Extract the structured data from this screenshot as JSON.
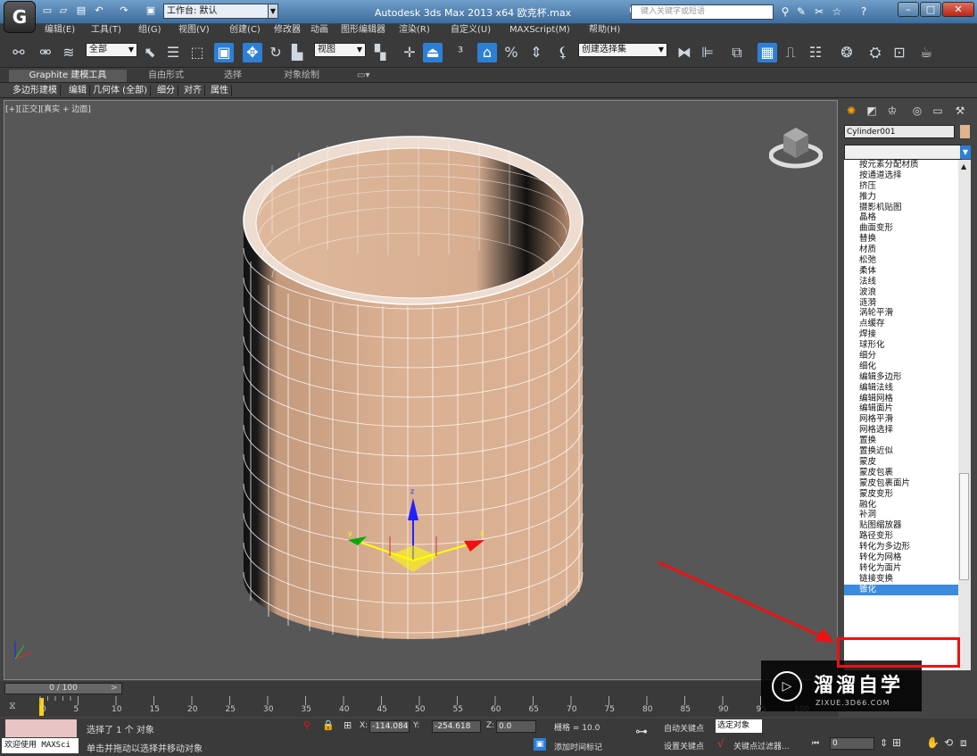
{
  "app": {
    "logo": "G",
    "title": "Autodesk 3ds Max  2013 x64    欧克杯.max",
    "workspace": "工作台: 默认",
    "search_placeholder": "键入关键字或短语"
  },
  "menus": [
    {
      "label": "编辑(E)"
    },
    {
      "label": "工具(T)"
    },
    {
      "label": "组(G)"
    },
    {
      "label": "视图(V)"
    },
    {
      "label": "创建(C)"
    },
    {
      "label": "修改器"
    },
    {
      "label": "动画"
    },
    {
      "label": "图形编辑器"
    },
    {
      "label": "渲染(R)"
    },
    {
      "label": "自定义(U)"
    },
    {
      "label": "MAXScript(M)"
    },
    {
      "label": "帮助(H)"
    }
  ],
  "toolbar": {
    "filter": "全部",
    "ref_coord": "视图",
    "named_sel": "创建选择集"
  },
  "ribbon": {
    "tabs": [
      "Graphite 建模工具",
      "自由形式",
      "选择",
      "对象绘制"
    ]
  },
  "subribbon": [
    "多边形建模",
    "编辑",
    "几何体 (全部)",
    "细分",
    "对齐",
    "属性"
  ],
  "viewport": {
    "label": "[+][正交][真实 + 边面]"
  },
  "command_panel": {
    "object_name": "Cylinder001",
    "object_color": "#dfb48e",
    "modifiers": [
      "按元素分配材质",
      "按通道选择",
      "挤压",
      "推力",
      "摄影机贴图",
      "晶格",
      "曲面变形",
      "替换",
      "材质",
      "松弛",
      "柔体",
      "法线",
      "波浪",
      "涟漪",
      "涡轮平滑",
      "点缓存",
      "焊接",
      "球形化",
      "细分",
      "细化",
      "编辑多边形",
      "编辑法线",
      "编辑网格",
      "编辑面片",
      "网格平滑",
      "网格选择",
      "置换",
      "置换近似",
      "蒙皮",
      "蒙皮包裹",
      "蒙皮包裹面片",
      "蒙皮变形",
      "融化",
      "补洞",
      "贴图缩放器",
      "路径变形",
      "转化为多边形",
      "转化为网格",
      "转化为面片",
      "链接变换",
      "锥化"
    ],
    "selected_modifier": "锥化"
  },
  "timeline": {
    "frame": "0 / 100",
    "ticks": [
      "0",
      "5",
      "10",
      "15",
      "20",
      "25",
      "30",
      "35",
      "40",
      "45",
      "50",
      "55",
      "60",
      "65",
      "70",
      "75",
      "80",
      "85",
      "90",
      "95",
      "100"
    ]
  },
  "status": {
    "selected": "选择了 1 个 对象",
    "prompt": "单击并拖动以选择并移动对象",
    "maxscript": "欢迎使用 MAXSci",
    "x": "-114.084",
    "y": "-254.618",
    "z": "0.0",
    "grid": "栅格 = 10.0",
    "auto_key": "自动关键点",
    "set_key": "设置关键点",
    "selected_obj": "选定对象",
    "key_filters": "关键点过滤器...",
    "add_time_tag": "添加时间标记",
    "frame_field": "0"
  },
  "watermark": {
    "cn": "溜溜自学",
    "en": "ZIXUE.3D66.COM"
  }
}
